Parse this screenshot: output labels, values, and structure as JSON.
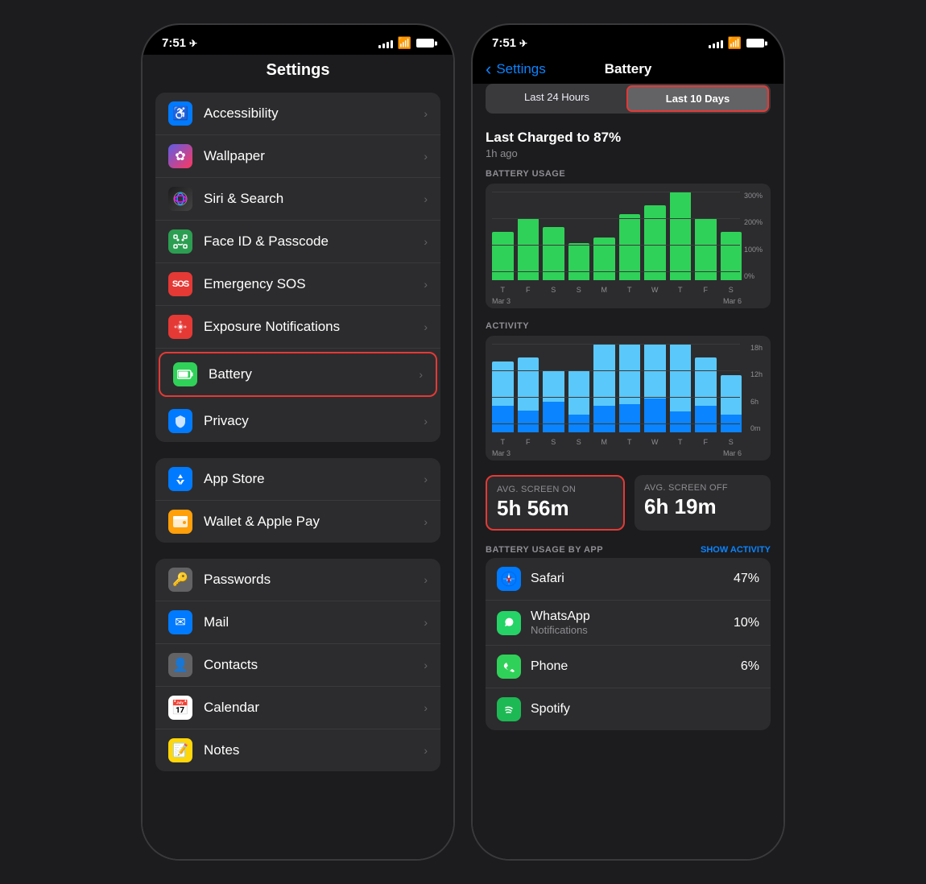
{
  "phone1": {
    "statusBar": {
      "time": "7:51",
      "locationIcon": "◂",
      "signalBars": [
        3,
        5,
        7,
        9,
        11
      ],
      "wifiLabel": "wifi",
      "batteryLabel": "battery"
    },
    "title": "Settings",
    "groups": [
      {
        "id": "group1",
        "items": [
          {
            "id": "accessibility",
            "icon": "♿",
            "iconBg": "#007aff",
            "label": "Accessibility",
            "highlighted": false
          },
          {
            "id": "wallpaper",
            "icon": "✿",
            "iconBg": "#5e5ce6",
            "label": "Wallpaper",
            "highlighted": false
          },
          {
            "id": "siri",
            "icon": "◉",
            "iconBg": "#1c1c1e",
            "iconGrad": true,
            "label": "Siri & Search",
            "highlighted": false
          },
          {
            "id": "faceid",
            "icon": "⬡",
            "iconBg": "#2c9e52",
            "label": "Face ID & Passcode",
            "highlighted": false
          },
          {
            "id": "sos",
            "icon": "SOS",
            "iconBg": "#e53935",
            "label": "Emergency SOS",
            "highlighted": false
          },
          {
            "id": "exposure",
            "icon": "⊙",
            "iconBg": "#e53935",
            "label": "Exposure Notifications",
            "highlighted": false
          },
          {
            "id": "battery",
            "icon": "▬",
            "iconBg": "#30d158",
            "label": "Battery",
            "highlighted": true
          },
          {
            "id": "privacy",
            "icon": "✋",
            "iconBg": "#007aff",
            "label": "Privacy",
            "highlighted": false
          }
        ]
      },
      {
        "id": "group2",
        "items": [
          {
            "id": "appstore",
            "icon": "A",
            "iconBg": "#007aff",
            "label": "App Store",
            "highlighted": false
          },
          {
            "id": "wallet",
            "icon": "▤",
            "iconBg": "#ff9f0a",
            "label": "Wallet & Apple Pay",
            "highlighted": false
          }
        ]
      },
      {
        "id": "group3",
        "items": [
          {
            "id": "passwords",
            "icon": "🔑",
            "iconBg": "#636366",
            "label": "Passwords",
            "highlighted": false
          },
          {
            "id": "mail",
            "icon": "✉",
            "iconBg": "#007aff",
            "label": "Mail",
            "highlighted": false
          },
          {
            "id": "contacts",
            "icon": "👤",
            "iconBg": "#636366",
            "label": "Contacts",
            "highlighted": false
          },
          {
            "id": "calendar",
            "icon": "📅",
            "iconBg": "#e53935",
            "label": "Calendar",
            "highlighted": false
          },
          {
            "id": "notes",
            "icon": "📝",
            "iconBg": "#ffd60a",
            "label": "Notes",
            "highlighted": false
          }
        ]
      }
    ]
  },
  "phone2": {
    "statusBar": {
      "time": "7:51",
      "locationIcon": "◂"
    },
    "nav": {
      "backLabel": "Settings",
      "title": "Battery"
    },
    "segmentControl": {
      "option1": "Last 24 Hours",
      "option2": "Last 10 Days",
      "activeIndex": 1
    },
    "lastCharged": {
      "title": "Last Charged to 87%",
      "subtitle": "1h ago"
    },
    "batteryUsage": {
      "label": "BATTERY USAGE",
      "yLabels": [
        "300%",
        "200%",
        "100%",
        "0%"
      ],
      "bars": [
        55,
        70,
        65,
        45,
        50,
        80,
        90,
        110,
        75,
        60
      ],
      "xLabels": [
        "T",
        "F",
        "S",
        "S",
        "M",
        "T",
        "W",
        "T",
        "F",
        "S"
      ],
      "dates": [
        "Mar 3",
        "Mar 6"
      ]
    },
    "activity": {
      "label": "ACTIVITY",
      "yLabels": [
        "18h",
        "12h",
        "6h",
        "0m"
      ],
      "bars": [
        {
          "screen": 50,
          "bg": 30
        },
        {
          "screen": 65,
          "bg": 25
        },
        {
          "screen": 40,
          "bg": 35
        },
        {
          "screen": 55,
          "bg": 20
        },
        {
          "screen": 75,
          "bg": 30
        },
        {
          "screen": 80,
          "bg": 35
        },
        {
          "screen": 70,
          "bg": 40
        },
        {
          "screen": 85,
          "bg": 25
        },
        {
          "screen": 60,
          "bg": 30
        },
        {
          "screen": 50,
          "bg": 20
        }
      ],
      "xLabels": [
        "T",
        "F",
        "S",
        "S",
        "M",
        "T",
        "W",
        "T",
        "F",
        "S"
      ],
      "dates": [
        "Mar 3",
        "Mar 6"
      ]
    },
    "screenStats": {
      "onTitle": "Avg. Screen On",
      "onValue": "5h 56m",
      "offTitle": "Avg. Screen Off",
      "offValue": "6h 19m"
    },
    "usageByApp": {
      "title": "BATTERY USAGE BY APP",
      "showActivityLabel": "SHOW ACTIVITY",
      "apps": [
        {
          "id": "safari",
          "icon": "🧭",
          "iconBg": "#007aff",
          "name": "Safari",
          "sub": "",
          "pct": "47%"
        },
        {
          "id": "whatsapp",
          "icon": "💬",
          "iconBg": "#25d366",
          "name": "WhatsApp",
          "sub": "Notifications",
          "pct": "10%"
        },
        {
          "id": "phone",
          "icon": "📞",
          "iconBg": "#30d158",
          "name": "Phone",
          "sub": "",
          "pct": "6%"
        },
        {
          "id": "spotify",
          "icon": "♫",
          "iconBg": "#1db954",
          "name": "Spotify",
          "sub": "",
          "pct": ""
        }
      ]
    }
  }
}
